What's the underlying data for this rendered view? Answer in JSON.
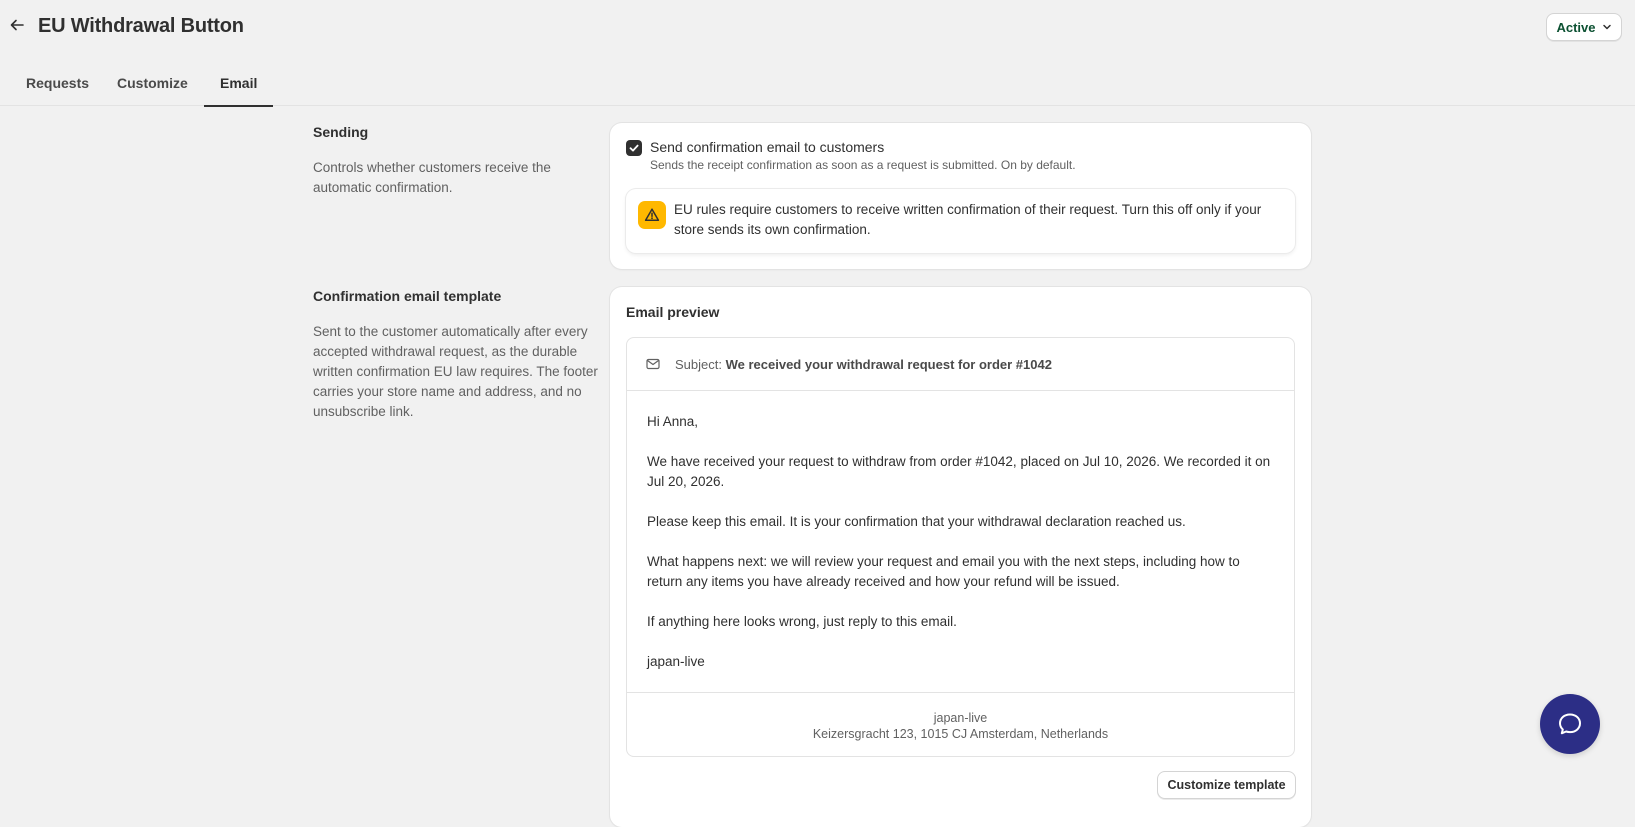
{
  "header": {
    "title": "EU Withdrawal Button",
    "status_label": "Active"
  },
  "tabs": [
    {
      "label": "Requests",
      "active": false
    },
    {
      "label": "Customize",
      "active": false
    },
    {
      "label": "Email",
      "active": true
    }
  ],
  "sending": {
    "title": "Sending",
    "description": "Controls whether customers receive the automatic confirmation.",
    "checkbox_label": "Send confirmation email to customers",
    "checkbox_checked": true,
    "checkbox_help": "Sends the receipt confirmation as soon as a request is submitted. On by default.",
    "warning_text": "EU rules require customers to receive written confirmation of their request. Turn this off only if your store sends its own confirmation."
  },
  "template": {
    "title": "Confirmation email template",
    "description": "Sent to the customer automatically after every accepted withdrawal request, as the durable written confirmation EU law requires. The footer carries your store name and address, and no unsubscribe link.",
    "preview_heading": "Email preview",
    "subject_prefix": "Subject:",
    "subject": "We received your withdrawal request for order #1042",
    "body": [
      "Hi Anna,",
      "We have received your request to withdraw from order #1042, placed on Jul 10, 2026. We recorded it on Jul 20, 2026.",
      "Please keep this email. It is your confirmation that your withdrawal declaration reached us.",
      "What happens next: we will review your request and email you with the next steps, including how to return any items you have already received and how your refund will be issued.",
      "If anything here looks wrong, just reply to this email.",
      "japan-live"
    ],
    "footer_store": "japan-live",
    "footer_address": "Keizersgracht 123, 1015 CJ Amsterdam, Netherlands",
    "customize_button": "Customize template"
  },
  "colors": {
    "accent": "#303030",
    "status_text": "#0c5132",
    "warning": "#ffb800",
    "chat_button": "#2c2e86",
    "page_bg": "#f1f1f1"
  },
  "icons": {
    "back": "arrow-left-icon",
    "status": "chevron-down-icon",
    "checkbox": "checkmark-icon",
    "warning": "alert-triangle-icon",
    "subject": "mail-icon",
    "chat": "chat-bubble-icon"
  }
}
